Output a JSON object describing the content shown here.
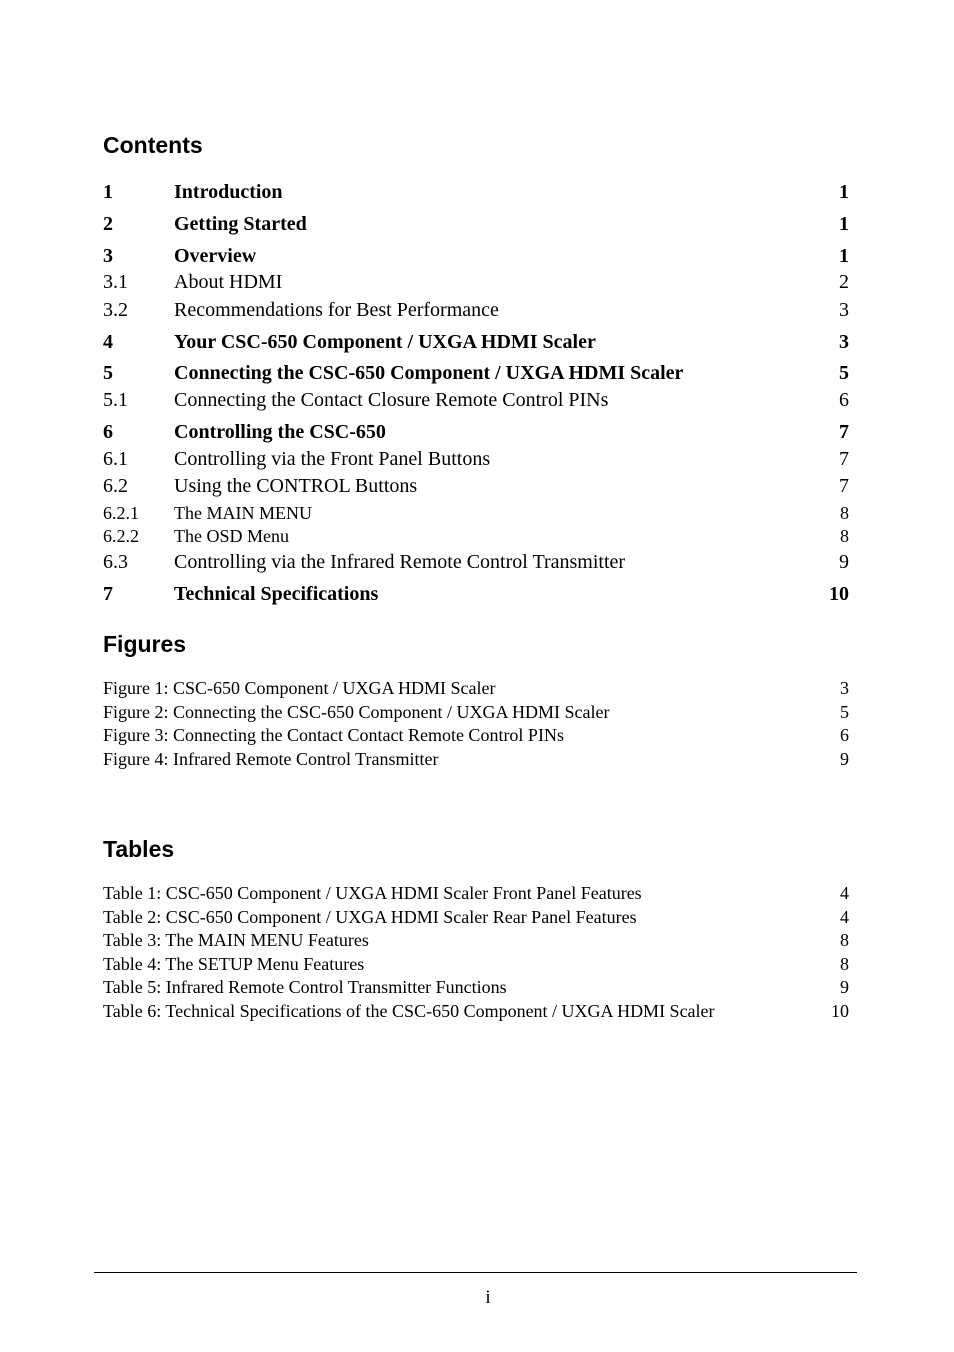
{
  "contents": {
    "heading": "Contents",
    "entries": [
      {
        "number": "1",
        "title": "Introduction",
        "page": "1",
        "level": 1
      },
      {
        "number": "2",
        "title": "Getting Started",
        "page": "1",
        "level": 1
      },
      {
        "number": "3",
        "title": "Overview",
        "page": "1",
        "level": 1
      },
      {
        "number": "3.1",
        "title": "About HDMI",
        "page": "2",
        "level": 2
      },
      {
        "number": "3.2",
        "title": "Recommendations for Best Performance",
        "page": "3",
        "level": 2
      },
      {
        "number": "4",
        "title": "Your CSC-650 Component / UXGA HDMI Scaler",
        "page": "3",
        "level": 1
      },
      {
        "number": "5",
        "title": "Connecting the CSC-650 Component / UXGA HDMI Scaler",
        "page": "5",
        "level": 1
      },
      {
        "number": "5.1",
        "title": "Connecting the Contact Closure Remote Control PINs",
        "page": "6",
        "level": 2
      },
      {
        "number": "6",
        "title": "Controlling the CSC-650",
        "page": "7",
        "level": 1
      },
      {
        "number": "6.1",
        "title": "Controlling via the Front Panel Buttons",
        "page": "7",
        "level": 2
      },
      {
        "number": "6.2",
        "title": "Using the CONTROL Buttons",
        "page": "7",
        "level": 2
      },
      {
        "number": "6.2.1",
        "title": "The MAIN MENU",
        "page": "8",
        "level": 3
      },
      {
        "number": "6.2.2",
        "title": "The OSD Menu",
        "page": "8",
        "level": 3
      },
      {
        "number": "6.3",
        "title": "Controlling via the Infrared Remote Control Transmitter",
        "page": "9",
        "level": 2
      },
      {
        "number": "7",
        "title": "Technical Specifications",
        "page": "10",
        "level": 1
      }
    ]
  },
  "figures": {
    "heading": "Figures",
    "entries": [
      {
        "title": "Figure 1: CSC-650 Component / UXGA HDMI Scaler",
        "page": "3"
      },
      {
        "title": "Figure 2: Connecting the CSC-650 Component / UXGA HDMI Scaler",
        "page": "5"
      },
      {
        "title": "Figure 3: Connecting the Contact Contact Remote Control PINs",
        "page": "6"
      },
      {
        "title": "Figure 4: Infrared Remote Control Transmitter",
        "page": "9"
      }
    ]
  },
  "tables": {
    "heading": "Tables",
    "entries": [
      {
        "title": "Table 1: CSC-650 Component / UXGA HDMI Scaler Front Panel Features",
        "page": "4"
      },
      {
        "title": "Table 2: CSC-650 Component / UXGA HDMI Scaler Rear Panel Features",
        "page": "4"
      },
      {
        "title": "Table 3: The MAIN MENU Features",
        "page": "8"
      },
      {
        "title": "Table 4: The SETUP Menu Features",
        "page": "8"
      },
      {
        "title": "Table 5: Infrared Remote Control Transmitter Functions",
        "page": "9"
      },
      {
        "title": "Table 6: Technical Specifications of the CSC-650 Component / UXGA HDMI Scaler",
        "page": "10"
      }
    ]
  },
  "footer": {
    "page_number": "i"
  }
}
